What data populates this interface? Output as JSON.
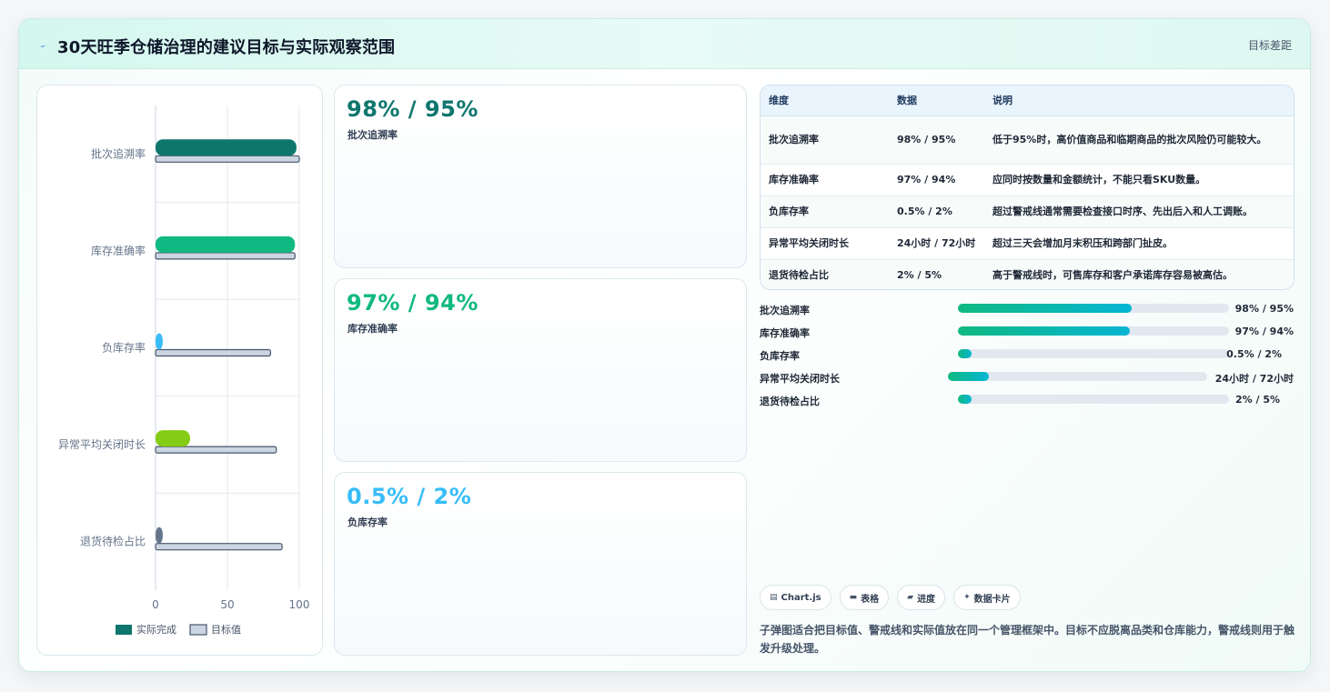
{
  "header": {
    "title": "30天旺季仓储治理的建议目标与实际观察范围",
    "link": "目标差距"
  },
  "chart_data": {
    "type": "bar",
    "orientation": "horizontal",
    "categories": [
      "批次追溯率",
      "库存准确率",
      "负库存率",
      "异常平均关闭时长",
      "退货待检占比"
    ],
    "series": [
      {
        "name": "实际完成",
        "values": [
          98,
          97,
          5,
          24,
          5
        ]
      },
      {
        "name": "目标值",
        "values": [
          100,
          97,
          80,
          84,
          88
        ]
      }
    ],
    "xticks": [
      "0",
      "50",
      "100"
    ],
    "xlim": [
      0,
      100
    ],
    "legend_position": "bottom",
    "grid": true
  },
  "kpis": [
    {
      "value": "98% / 95%",
      "label": "批次追溯率"
    },
    {
      "value": "97% / 94%",
      "label": "库存准确率"
    },
    {
      "value": "0.5% / 2%",
      "label": "负库存率"
    }
  ],
  "table": {
    "headers": [
      "维度",
      "数据",
      "说明"
    ],
    "rows": [
      [
        "批次追溯率",
        "98% / 95%",
        "低于95%时，高价值商品和临期商品的批次风险仍可能较大。"
      ],
      [
        "库存准确率",
        "97% / 94%",
        "应同时按数量和金额统计，不能只看SKU数量。"
      ],
      [
        "负库存率",
        "0.5% / 2%",
        "超过警戒线通常需要检查接口时序、先出后入和人工调账。"
      ],
      [
        "异常平均关闭时长",
        "24小时 / 72小时",
        "超过三天会增加月末积压和跨部门扯皮。"
      ],
      [
        "退货待检占比",
        "2% / 5%",
        "高于警戒线时，可售库存和客户承诺库存容易被高估。"
      ]
    ]
  },
  "progress": [
    {
      "label": "批次追溯率",
      "value": "98% / 95%",
      "fill": 0.64
    },
    {
      "label": "库存准确率",
      "value": "97% / 94%",
      "fill": 0.635
    },
    {
      "label": "负库存率",
      "value": "0.5% / 2%",
      "fill": 0.05
    },
    {
      "label": "异常平均关闭时长",
      "value": "24小时 / 72小时",
      "fill": 0.157
    },
    {
      "label": "退货待检占比",
      "value": "2% / 5%",
      "fill": 0.05
    }
  ],
  "pills": [
    {
      "icon": "chart-icon",
      "label": "Chart.js"
    },
    {
      "icon": "table-icon",
      "label": "表格"
    },
    {
      "icon": "progress-icon",
      "label": "进度"
    },
    {
      "icon": "sparkle-icon",
      "label": "数据卡片"
    }
  ],
  "note": "子弹图适合把目标值、警戒线和实际值放在同一个管理框架中。目标不应脱离品类和仓库能力，警戒线则用于触发升级处理。",
  "colors": {
    "accent_teal": "#0f766e",
    "accent_green": "#10b981",
    "accent_sky": "#38bdf8",
    "accent_lime": "#84cc16",
    "accent_slate": "#64748b",
    "target_fill": "#cbd5e1"
  }
}
